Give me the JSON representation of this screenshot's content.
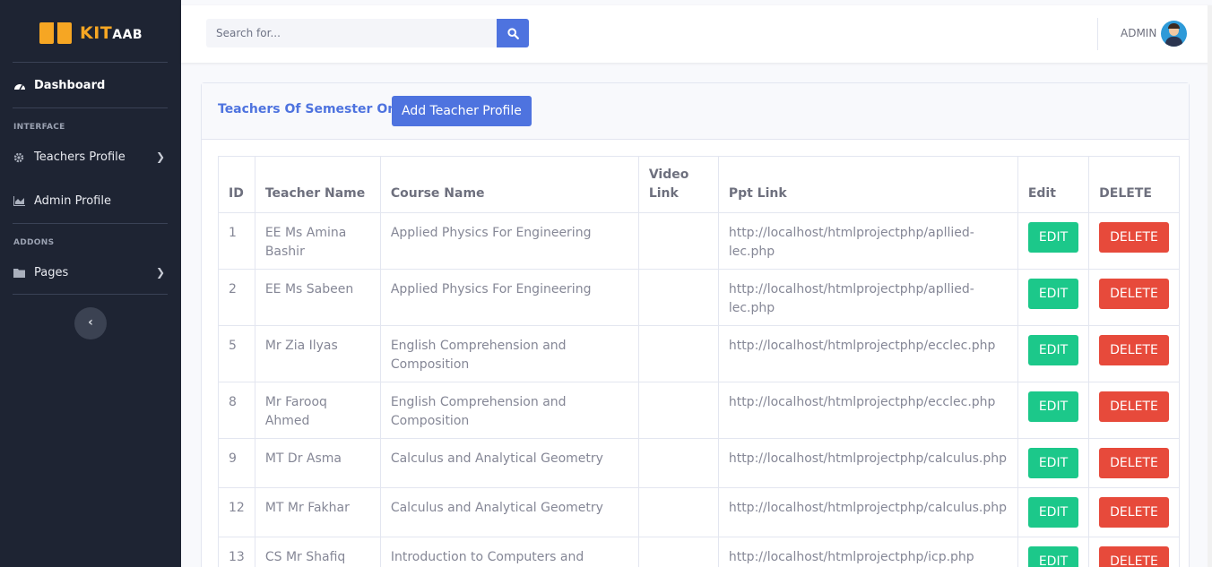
{
  "brand": {
    "name_main": "KIT",
    "name_small": "AAB"
  },
  "sidebar": {
    "dashboard": "Dashboard",
    "heading_interface": "INTERFACE",
    "teachers_profile": "Teachers Profile",
    "admin_profile": "Admin Profile",
    "heading_addons": "ADDONS",
    "pages": "Pages"
  },
  "topbar": {
    "search_placeholder": "Search for...",
    "user_label": "ADMIN"
  },
  "card": {
    "title": "Teachers Of Semester One",
    "add_button": "Add Teacher Profile"
  },
  "table": {
    "headers": [
      "ID",
      "Teacher Name",
      "Course Name",
      "Video Link",
      "Ppt Link",
      "Edit",
      "DELETE"
    ],
    "edit_label": "EDIT",
    "delete_label": "DELETE",
    "rows": [
      {
        "id": "1",
        "teacher": "EE Ms Amina Bashir",
        "course": "Applied Physics For Engineering",
        "video": "",
        "ppt": "http://localhost/htmlprojectphp/apllied­lec.php"
      },
      {
        "id": "2",
        "teacher": "EE Ms Sabeen",
        "course": "Applied Physics For Engineering",
        "video": "",
        "ppt": "http://localhost/htmlprojectphp/apllied­lec.php"
      },
      {
        "id": "5",
        "teacher": "Mr Zia Ilyas",
        "course": "English Comprehension and Composition",
        "video": "",
        "ppt": "http://localhost/htmlprojectphp/ecclec.php"
      },
      {
        "id": "8",
        "teacher": "Mr Farooq Ahmed",
        "course": "English Comprehension and Composition",
        "video": "",
        "ppt": "http://localhost/htmlprojectphp/ecclec.php"
      },
      {
        "id": "9",
        "teacher": "MT Dr Asma",
        "course": "Calculus and Analytical Geometry",
        "video": "",
        "ppt": "http://localhost/htmlprojectphp/calculus.php"
      },
      {
        "id": "12",
        "teacher": "MT Mr Fakhar",
        "course": "Calculus and Analytical Geometry",
        "video": "",
        "ppt": "http://localhost/htmlprojectphp/calculus.php"
      },
      {
        "id": "13",
        "teacher": "CS Mr Shafiq",
        "course": "Introduction to Computers and Programming",
        "video": "",
        "ppt": "http://localhost/htmlprojectphp/icp.php"
      }
    ]
  },
  "colors": {
    "primary": "#4e73df",
    "success": "#1cc88a",
    "danger": "#e74a3b",
    "sidebar": "#1e2433",
    "brand": "#f6a623"
  }
}
